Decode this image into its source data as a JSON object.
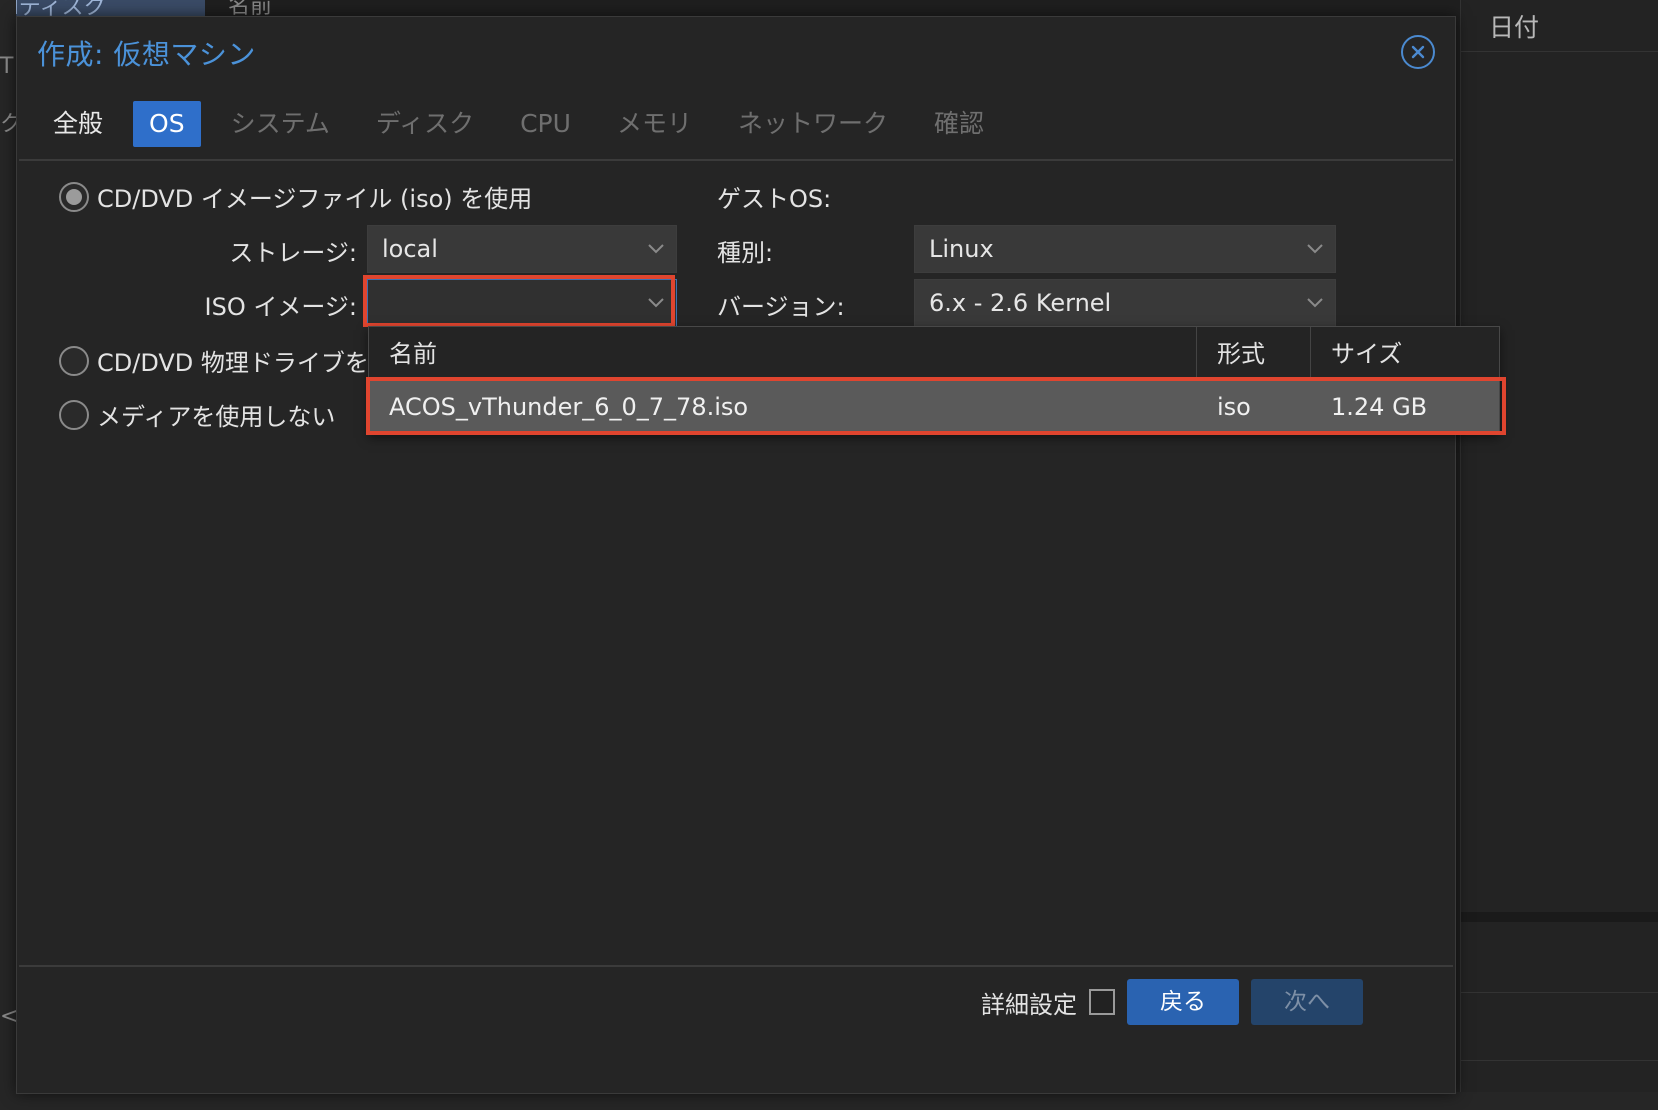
{
  "background": {
    "tab_fragment": "Mディスク",
    "name_fragment": "名前",
    "right_header": "日付",
    "left_fragments": [
      "T",
      "ク",
      "<"
    ]
  },
  "dialog": {
    "title": "作成: 仮想マシン",
    "tabs": [
      {
        "label": "全般"
      },
      {
        "label": "OS"
      },
      {
        "label": "システム"
      },
      {
        "label": "ディスク"
      },
      {
        "label": "CPU"
      },
      {
        "label": "メモリ"
      },
      {
        "label": "ネットワーク"
      },
      {
        "label": "確認"
      }
    ],
    "media": {
      "iso_option": "CD/DVD イメージファイル (iso) を使用",
      "physical_option": "CD/DVD 物理ドライブを",
      "none_option": "メディアを使用しない",
      "storage_label": "ストレージ:",
      "storage_value": "local",
      "iso_label": "ISO イメージ:",
      "iso_value": ""
    },
    "guest": {
      "heading": "ゲストOS:",
      "type_label": "種別:",
      "type_value": "Linux",
      "version_label": "バージョン:",
      "version_value": "6.x - 2.6 Kernel"
    },
    "iso_list": {
      "columns": [
        "名前",
        "形式",
        "サイズ"
      ],
      "rows": [
        {
          "name": "ACOS_vThunder_6_0_7_78.iso",
          "format": "iso",
          "size": "1.24 GB"
        }
      ]
    },
    "footer": {
      "advanced_label": "詳細設定",
      "back_label": "戻る",
      "next_label": "次へ"
    }
  },
  "colors": {
    "accent": "#2f6fca",
    "title": "#4b92d9",
    "highlight": "#e0452f"
  }
}
